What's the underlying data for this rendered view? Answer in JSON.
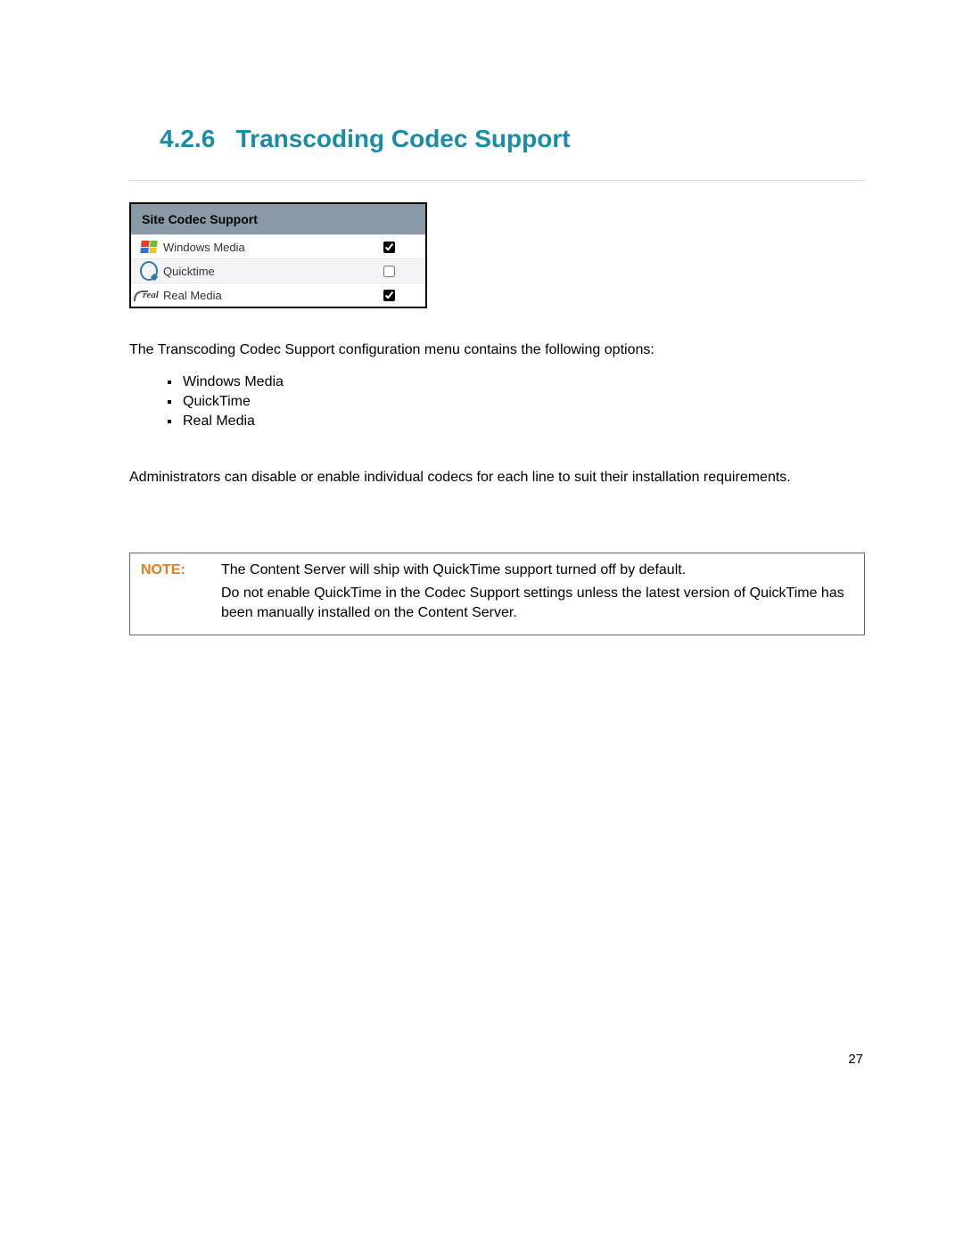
{
  "heading": {
    "number": "4.2.6",
    "title": "Transcoding Codec Support"
  },
  "codec_panel": {
    "header": "Site Codec Support",
    "rows": [
      {
        "icon": "windows-media-icon",
        "label": "Windows Media",
        "checked": true
      },
      {
        "icon": "quicktime-icon",
        "label": "Quicktime",
        "checked": false
      },
      {
        "icon": "real-media-icon",
        "label": "Real Media",
        "checked": true
      }
    ]
  },
  "intro_text": "The Transcoding Codec Support configuration menu contains the following options:",
  "options": [
    "Windows Media",
    "QuickTime",
    "Real Media"
  ],
  "admin_text": "Administrators can disable or enable individual codecs for each line to suit their installation requirements.",
  "note": {
    "label": "NOTE:",
    "line1": "The Content Server will ship with QuickTime support turned off by default.",
    "line2": "Do not enable QuickTime in the Codec Support settings unless the latest version of QuickTime has been manually installed on the Content Server."
  },
  "page_number": "27"
}
